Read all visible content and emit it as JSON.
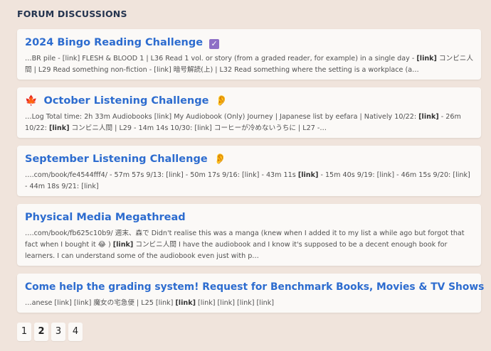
{
  "section": {
    "title": "FORUM DISCUSSIONS"
  },
  "topics": [
    {
      "title": "2024 Bingo Reading Challenge",
      "emoji": "✓",
      "excerpt_before": "…BR pile - [link] FLESH & BLOOD 1 | L36 Read 1 vol. or story (from a graded reader, for example) in a single day - ",
      "bold": "[link]",
      "excerpt_after": " コンビニ人間 | L29 Read something non-fiction - [link] 暗号解読(上) | L32 Read something where the setting is a workplace (a…"
    },
    {
      "title": "October Listening Challenge",
      "prefix_emoji": "🍁",
      "emoji": "👂",
      "excerpt_before": "…Log Total time: 2h 33m Audiobooks [link] My Audiobook (Only) Journey | Japanese list by eefara | Natively 10/22: ",
      "bold": "[link]",
      "excerpt_mid": " - 26m 10/22: ",
      "bold2": "[link]",
      "excerpt_after": " コンビニ人間 | L29 - 14m 14s 10/30: [link] コーヒーが冷めないうちに | L27 -…"
    },
    {
      "title": "September Listening Challenge",
      "emoji": "👂",
      "excerpt_before": "….com/book/fe4544fff4/ - 57m 57s 9/13: [link] - 50m 17s 9/16: [link] - 43m 11s ",
      "bold": "[link]",
      "excerpt_after": " - 15m 40s 9/19: [link] - 46m 15s 9/20: [link] - 44m 18s 9/21: [link]"
    },
    {
      "title": "Physical Media Megathread",
      "excerpt_before": "….com/book/fb625c10b9/ 週末、森で Didn't realise this was a manga (knew when I added it to my list a while ago but forgot that fact when I bought it 😂 ) ",
      "bold": "[link]",
      "excerpt_after": " コンビニ人間 I have the audiobook and I know it's supposed to be a decent enough book for learners. I can understand some of the audiobook even just with p…"
    },
    {
      "title": "Come help the grading system! Request for Benchmark Books, Movies & TV Shows",
      "excerpt_before": "…anese [link] [link] 魔女の宅急便 | L25 [link] ",
      "bold": "[link]",
      "excerpt_after": " [link] [link] [link] [link]"
    }
  ],
  "pagination": {
    "pages": [
      "1",
      "2",
      "3",
      "4"
    ],
    "current": "2"
  },
  "colors": {
    "background": "#f0e4dc",
    "card": "#fbf9f7",
    "link": "#2d6ccf",
    "heading": "#24344f"
  }
}
